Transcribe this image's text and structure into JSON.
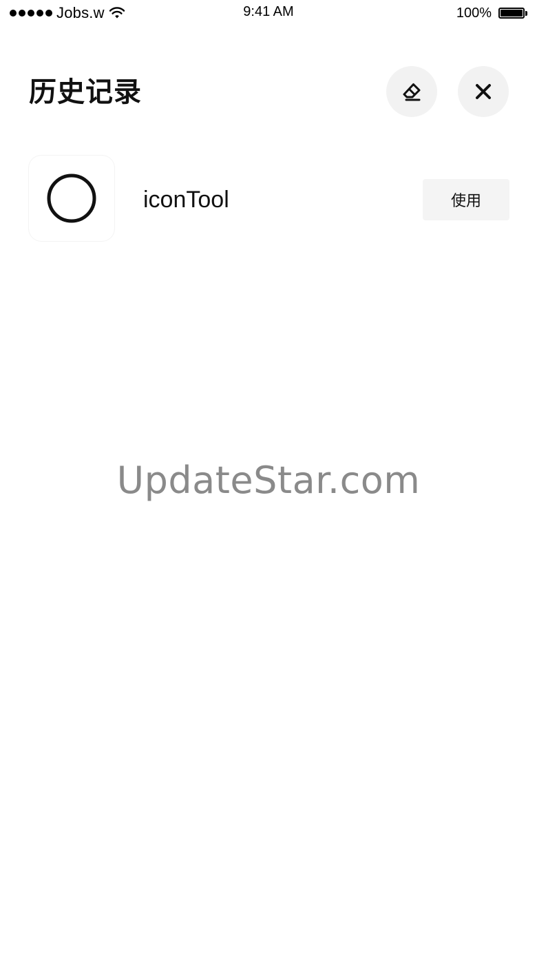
{
  "status_bar": {
    "carrier": "Jobs.w",
    "time": "9:41 AM",
    "battery_percent": "100%",
    "battery_level": 1.0,
    "signal_bars": 5
  },
  "header": {
    "title": "历史记录",
    "clear_icon": "eraser-icon",
    "close_icon": "close-icon"
  },
  "history": {
    "items": [
      {
        "icon": "circle-outline-icon",
        "name": "iconTool",
        "action_label": "使用"
      }
    ]
  },
  "watermark": {
    "text": "UpdateStar.com"
  },
  "colors": {
    "background": "#ffffff",
    "button_background": "#f2f2f2",
    "text": "#111111",
    "watermark": "#8a8a8a"
  }
}
